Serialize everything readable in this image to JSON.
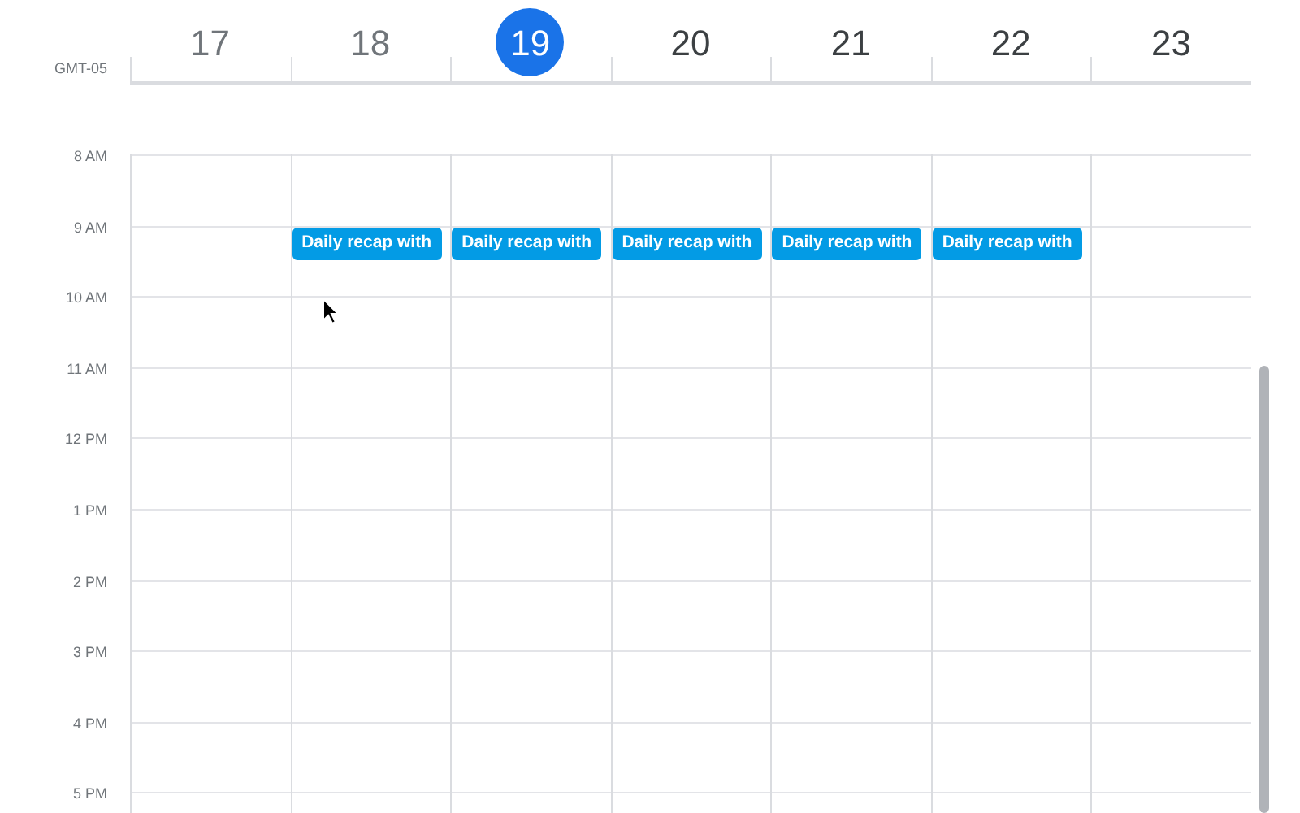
{
  "timezone": "GMT-05",
  "days": [
    {
      "date": "17",
      "selected": false
    },
    {
      "date": "18",
      "selected": false,
      "events": [
        {
          "title": "Daily recap with"
        }
      ]
    },
    {
      "date": "19",
      "selected": true,
      "events": [
        {
          "title": "Daily recap with"
        }
      ]
    },
    {
      "date": "20",
      "selected": false,
      "events": [
        {
          "title": "Daily recap with"
        }
      ]
    },
    {
      "date": "21",
      "selected": false,
      "events": [
        {
          "title": "Daily recap with"
        }
      ]
    },
    {
      "date": "22",
      "selected": false,
      "events": [
        {
          "title": "Daily recap with"
        }
      ]
    },
    {
      "date": "23",
      "selected": false
    }
  ],
  "hours": [
    "8 AM",
    "9 AM",
    "10 AM",
    "11 AM",
    "12 PM",
    "1 PM",
    "2 PM",
    "3 PM",
    "4 PM",
    "5 PM"
  ]
}
